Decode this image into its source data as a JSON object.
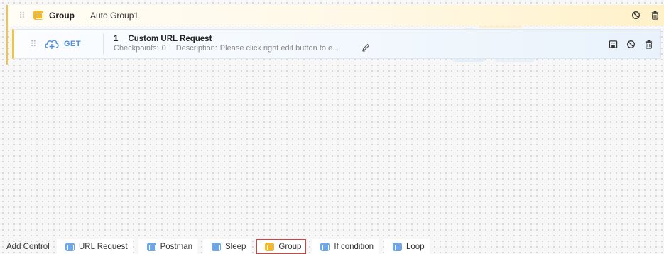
{
  "group": {
    "title": "Group",
    "name": "Auto Group1",
    "icon": "group-icon",
    "accent": "#f5c342"
  },
  "request": {
    "method": "GET",
    "method_color": "#4a90e2",
    "index": "1",
    "title": "Custom URL Request",
    "checkpoints_label": "Checkpoints:",
    "checkpoints_value": "0",
    "description_label": "Description:",
    "description_value": "Please click right edit button to e...",
    "icons": [
      "drag-handle-icon",
      "cloud-request-icon",
      "edit-icon",
      "save-icon",
      "disable-icon",
      "delete-icon"
    ]
  },
  "bottom_bar": {
    "label": "Add Control",
    "controls": [
      {
        "label": "URL Request",
        "icon": "url-request-icon",
        "color": "#6aa7ec",
        "active": false
      },
      {
        "label": "Postman",
        "icon": "postman-icon",
        "color": "#6aa7ec",
        "active": false
      },
      {
        "label": "Sleep",
        "icon": "sleep-icon",
        "color": "#6aa7ec",
        "active": false
      },
      {
        "label": "Group",
        "icon": "group-icon",
        "color": "#f7b824",
        "active": true
      },
      {
        "label": "If condition",
        "icon": "if-condition-icon",
        "color": "#6aa7ec",
        "active": false
      },
      {
        "label": "Loop",
        "icon": "loop-icon",
        "color": "#6aa7ec",
        "active": false
      }
    ],
    "active_border_color": "#e23b3b"
  }
}
